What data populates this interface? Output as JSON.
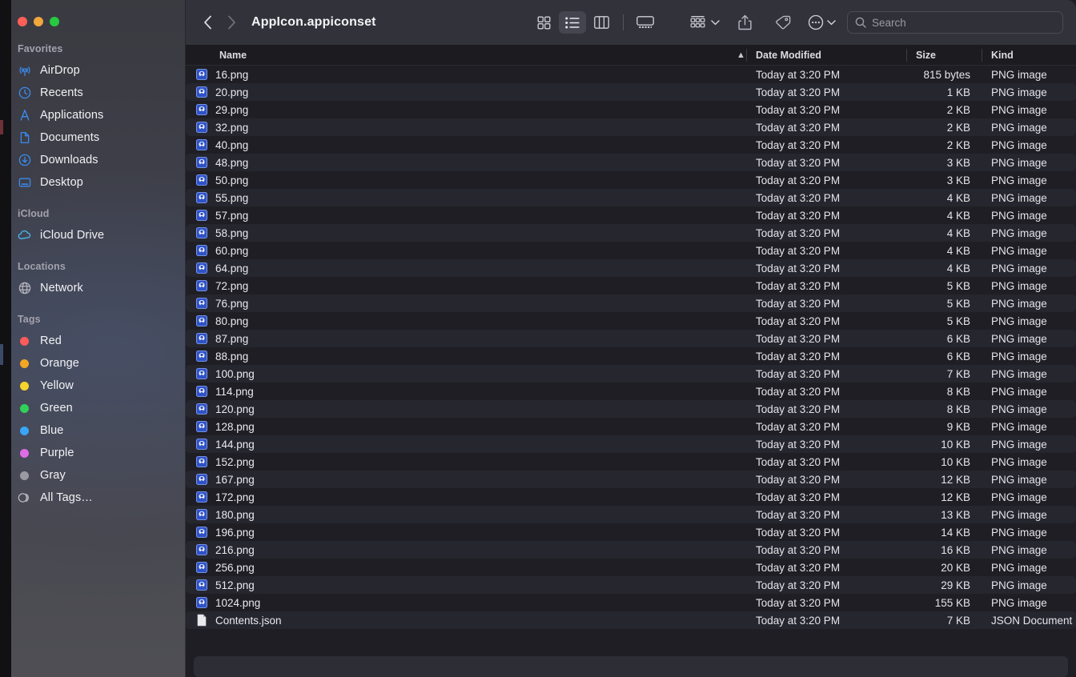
{
  "window": {
    "title": "AppIcon.appiconset",
    "traffic_lights": [
      "close",
      "minimize",
      "zoom"
    ],
    "colors": {
      "toolbar_bg": "#32323a",
      "content_bg": "#1e1e24",
      "row_alt_bg": "#26262e",
      "accent_blue": "#2f7ce0",
      "sidebar_icon_blue": "#3b8bf0"
    }
  },
  "toolbar": {
    "back_label": "Back",
    "forward_label": "Forward",
    "view_buttons": [
      {
        "name": "icon-view",
        "label": "Icon View",
        "active": false
      },
      {
        "name": "list-view",
        "label": "List View",
        "active": true
      },
      {
        "name": "column-view",
        "label": "Column View",
        "active": false
      },
      {
        "name": "gallery-view",
        "label": "Gallery View",
        "active": false
      }
    ],
    "group_label": "Group",
    "share_label": "Share",
    "tags_label": "Tags",
    "more_label": "More"
  },
  "search": {
    "placeholder": "Search",
    "value": ""
  },
  "sidebar": {
    "sections": [
      {
        "title": "Favorites",
        "items": [
          {
            "label": "AirDrop",
            "icon": "airdrop-icon"
          },
          {
            "label": "Recents",
            "icon": "clock-icon"
          },
          {
            "label": "Applications",
            "icon": "applications-icon"
          },
          {
            "label": "Documents",
            "icon": "document-icon"
          },
          {
            "label": "Downloads",
            "icon": "download-icon"
          },
          {
            "label": "Desktop",
            "icon": "desktop-icon"
          }
        ]
      },
      {
        "title": "iCloud",
        "items": [
          {
            "label": "iCloud Drive",
            "icon": "cloud-icon"
          }
        ]
      },
      {
        "title": "Locations",
        "items": [
          {
            "label": "Network",
            "icon": "globe-icon"
          }
        ]
      },
      {
        "title": "Tags",
        "items": [
          {
            "label": "Red",
            "icon": "tag-dot",
            "color": "#ff5b5b"
          },
          {
            "label": "Orange",
            "icon": "tag-dot",
            "color": "#f5a623"
          },
          {
            "label": "Yellow",
            "icon": "tag-dot",
            "color": "#f6d42b"
          },
          {
            "label": "Green",
            "icon": "tag-dot",
            "color": "#30d158"
          },
          {
            "label": "Blue",
            "icon": "tag-dot",
            "color": "#3aa4f5"
          },
          {
            "label": "Purple",
            "icon": "tag-dot",
            "color": "#e06ce8"
          },
          {
            "label": "Gray",
            "icon": "tag-dot",
            "color": "#9a9aa2"
          },
          {
            "label": "All Tags…",
            "icon": "all-tags-icon",
            "color": ""
          }
        ]
      }
    ]
  },
  "file_list": {
    "columns": [
      "Name",
      "Date Modified",
      "Size",
      "Kind"
    ],
    "sort_column": "Name",
    "sort_direction": "ascending",
    "rows": [
      {
        "name": "16.png",
        "date": "Today at 3:20 PM",
        "size": "815 bytes",
        "kind": "PNG image",
        "icon": "png-icon"
      },
      {
        "name": "20.png",
        "date": "Today at 3:20 PM",
        "size": "1 KB",
        "kind": "PNG image",
        "icon": "png-icon"
      },
      {
        "name": "29.png",
        "date": "Today at 3:20 PM",
        "size": "2 KB",
        "kind": "PNG image",
        "icon": "png-icon"
      },
      {
        "name": "32.png",
        "date": "Today at 3:20 PM",
        "size": "2 KB",
        "kind": "PNG image",
        "icon": "png-icon"
      },
      {
        "name": "40.png",
        "date": "Today at 3:20 PM",
        "size": "2 KB",
        "kind": "PNG image",
        "icon": "png-icon"
      },
      {
        "name": "48.png",
        "date": "Today at 3:20 PM",
        "size": "3 KB",
        "kind": "PNG image",
        "icon": "png-icon"
      },
      {
        "name": "50.png",
        "date": "Today at 3:20 PM",
        "size": "3 KB",
        "kind": "PNG image",
        "icon": "png-icon"
      },
      {
        "name": "55.png",
        "date": "Today at 3:20 PM",
        "size": "4 KB",
        "kind": "PNG image",
        "icon": "png-icon"
      },
      {
        "name": "57.png",
        "date": "Today at 3:20 PM",
        "size": "4 KB",
        "kind": "PNG image",
        "icon": "png-icon"
      },
      {
        "name": "58.png",
        "date": "Today at 3:20 PM",
        "size": "4 KB",
        "kind": "PNG image",
        "icon": "png-icon"
      },
      {
        "name": "60.png",
        "date": "Today at 3:20 PM",
        "size": "4 KB",
        "kind": "PNG image",
        "icon": "png-icon"
      },
      {
        "name": "64.png",
        "date": "Today at 3:20 PM",
        "size": "4 KB",
        "kind": "PNG image",
        "icon": "png-icon"
      },
      {
        "name": "72.png",
        "date": "Today at 3:20 PM",
        "size": "5 KB",
        "kind": "PNG image",
        "icon": "png-icon"
      },
      {
        "name": "76.png",
        "date": "Today at 3:20 PM",
        "size": "5 KB",
        "kind": "PNG image",
        "icon": "png-icon"
      },
      {
        "name": "80.png",
        "date": "Today at 3:20 PM",
        "size": "5 KB",
        "kind": "PNG image",
        "icon": "png-icon"
      },
      {
        "name": "87.png",
        "date": "Today at 3:20 PM",
        "size": "6 KB",
        "kind": "PNG image",
        "icon": "png-icon"
      },
      {
        "name": "88.png",
        "date": "Today at 3:20 PM",
        "size": "6 KB",
        "kind": "PNG image",
        "icon": "png-icon"
      },
      {
        "name": "100.png",
        "date": "Today at 3:20 PM",
        "size": "7 KB",
        "kind": "PNG image",
        "icon": "png-icon"
      },
      {
        "name": "114.png",
        "date": "Today at 3:20 PM",
        "size": "8 KB",
        "kind": "PNG image",
        "icon": "png-icon"
      },
      {
        "name": "120.png",
        "date": "Today at 3:20 PM",
        "size": "8 KB",
        "kind": "PNG image",
        "icon": "png-icon"
      },
      {
        "name": "128.png",
        "date": "Today at 3:20 PM",
        "size": "9 KB",
        "kind": "PNG image",
        "icon": "png-icon"
      },
      {
        "name": "144.png",
        "date": "Today at 3:20 PM",
        "size": "10 KB",
        "kind": "PNG image",
        "icon": "png-icon"
      },
      {
        "name": "152.png",
        "date": "Today at 3:20 PM",
        "size": "10 KB",
        "kind": "PNG image",
        "icon": "png-icon"
      },
      {
        "name": "167.png",
        "date": "Today at 3:20 PM",
        "size": "12 KB",
        "kind": "PNG image",
        "icon": "png-icon"
      },
      {
        "name": "172.png",
        "date": "Today at 3:20 PM",
        "size": "12 KB",
        "kind": "PNG image",
        "icon": "png-icon"
      },
      {
        "name": "180.png",
        "date": "Today at 3:20 PM",
        "size": "13 KB",
        "kind": "PNG image",
        "icon": "png-icon"
      },
      {
        "name": "196.png",
        "date": "Today at 3:20 PM",
        "size": "14 KB",
        "kind": "PNG image",
        "icon": "png-icon"
      },
      {
        "name": "216.png",
        "date": "Today at 3:20 PM",
        "size": "16 KB",
        "kind": "PNG image",
        "icon": "png-icon"
      },
      {
        "name": "256.png",
        "date": "Today at 3:20 PM",
        "size": "20 KB",
        "kind": "PNG image",
        "icon": "png-icon"
      },
      {
        "name": "512.png",
        "date": "Today at 3:20 PM",
        "size": "29 KB",
        "kind": "PNG image",
        "icon": "png-icon"
      },
      {
        "name": "1024.png",
        "date": "Today at 3:20 PM",
        "size": "155 KB",
        "kind": "PNG image",
        "icon": "png-icon"
      },
      {
        "name": "Contents.json",
        "date": "Today at 3:20 PM",
        "size": "7 KB",
        "kind": "JSON Document",
        "icon": "json-icon"
      }
    ]
  }
}
